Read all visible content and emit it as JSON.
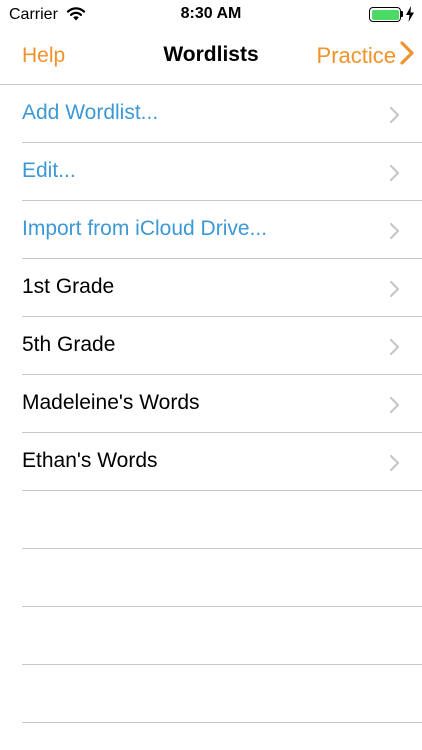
{
  "status_bar": {
    "carrier": "Carrier",
    "time": "8:30 AM",
    "battery_color": "#4cd964"
  },
  "nav": {
    "left": "Help",
    "title": "Wordlists",
    "right": "Practice",
    "accent_color": "#f0932b"
  },
  "rows": [
    {
      "label": "Add Wordlist...",
      "style": "action"
    },
    {
      "label": "Edit...",
      "style": "action"
    },
    {
      "label": "Import from iCloud Drive...",
      "style": "action"
    },
    {
      "label": "1st Grade",
      "style": "normal"
    },
    {
      "label": "5th Grade",
      "style": "normal"
    },
    {
      "label": "Madeleine's Words",
      "style": "normal"
    },
    {
      "label": "Ethan's Words",
      "style": "normal"
    }
  ],
  "action_color": "#3c99d6",
  "icons": {
    "wifi": "wifi-icon",
    "battery": "battery-icon",
    "charging": "charging-bolt-icon",
    "forward": "chevron-right-icon"
  }
}
